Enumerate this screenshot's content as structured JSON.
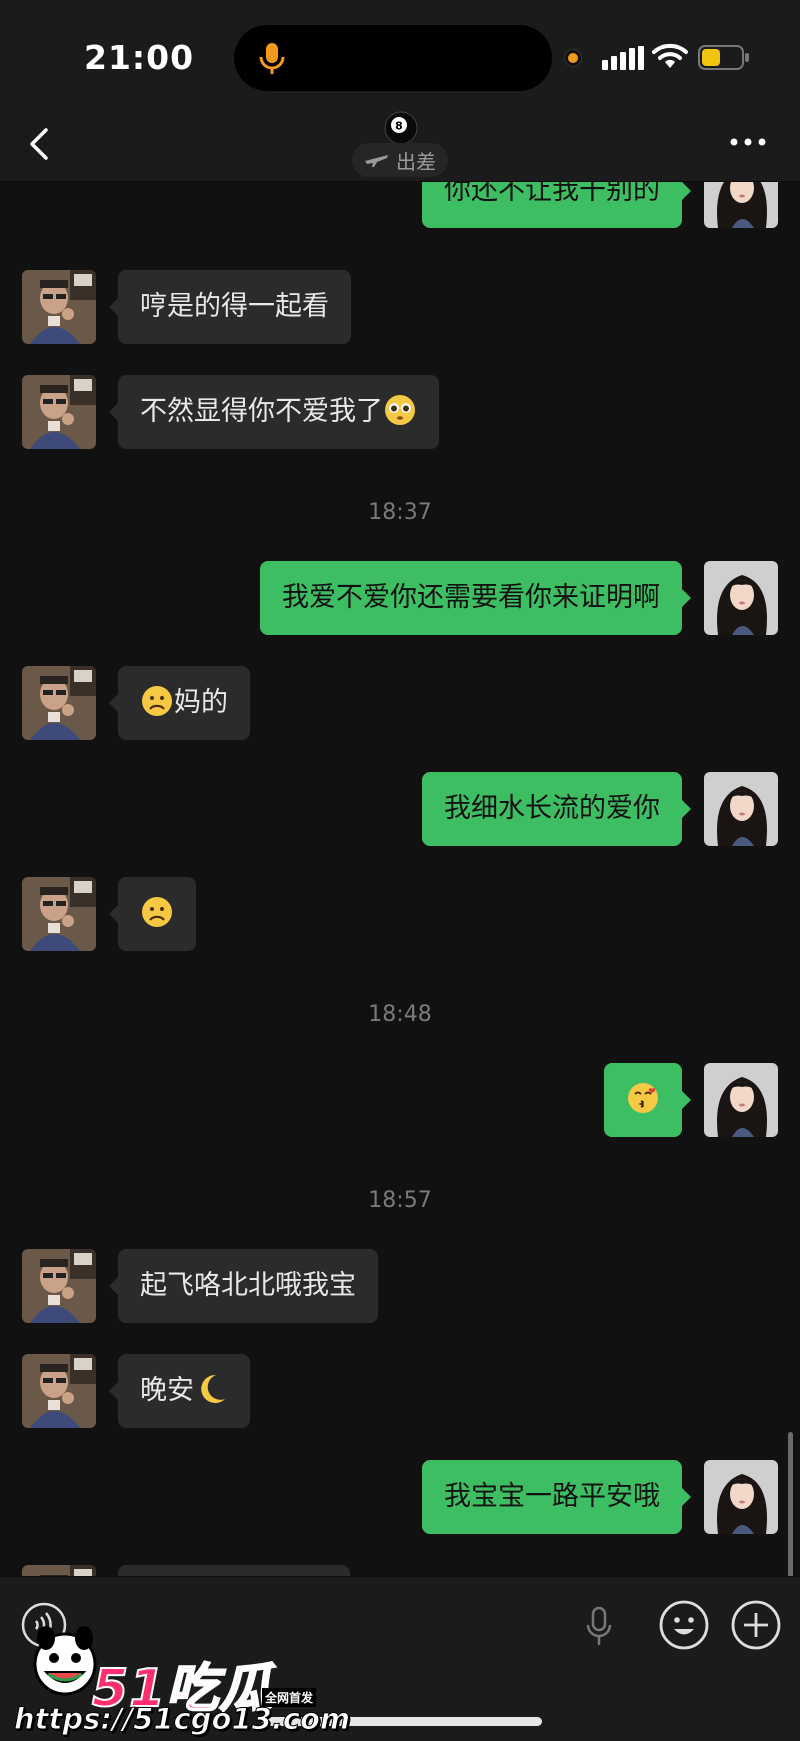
{
  "status_bar": {
    "time": "21:00"
  },
  "header": {
    "contact_status": "出差"
  },
  "messages": [
    {
      "side": "out",
      "text": "你还不让我干别的"
    },
    {
      "side": "in",
      "text": "哼是的得一起看"
    },
    {
      "side": "in",
      "text": "不然显得你不爱我了",
      "emoji": "pleading-face"
    },
    {
      "timestamp": "18:37"
    },
    {
      "side": "out",
      "text": "我爱不爱你还需要看你来证明啊"
    },
    {
      "side": "in",
      "text": "妈的",
      "emoji": "frowning-face",
      "emoji_first": true
    },
    {
      "side": "out",
      "text": "我细水长流的爱你"
    },
    {
      "side": "in",
      "text": "",
      "emoji": "frowning-face"
    },
    {
      "timestamp": "18:48"
    },
    {
      "side": "out",
      "text": "",
      "emoji": "kissing-face"
    },
    {
      "timestamp": "18:57"
    },
    {
      "side": "in",
      "text": "起飞咯北北哦我宝"
    },
    {
      "side": "in",
      "text": "晚安",
      "emoji": "crescent-moon"
    },
    {
      "side": "out",
      "text": "我宝宝一路平安哦"
    }
  ],
  "watermark": {
    "logo_text": "51吃瓜",
    "url": "https://51cgo13.com",
    "tag": "全网首发"
  }
}
